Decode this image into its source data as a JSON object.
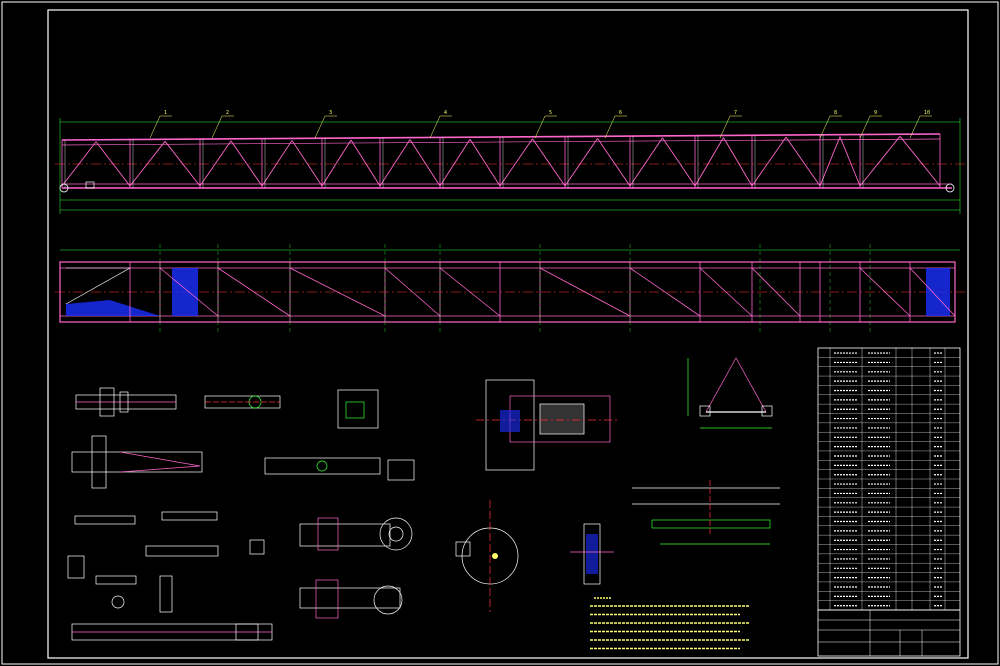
{
  "drawing": {
    "background": "#000000",
    "colors": {
      "frame": "#ffffff",
      "member": "#ff66cc",
      "dimension": "#33ff33",
      "centerline": "#ff3333",
      "annotation": "#ffff66",
      "hatch": "#1a2fff",
      "outline": "#ffffff"
    },
    "balloons_elevation": [
      "1",
      "2",
      "3",
      "4",
      "5",
      "6",
      "7",
      "8",
      "9",
      "10"
    ],
    "title_block_rows": 28
  }
}
